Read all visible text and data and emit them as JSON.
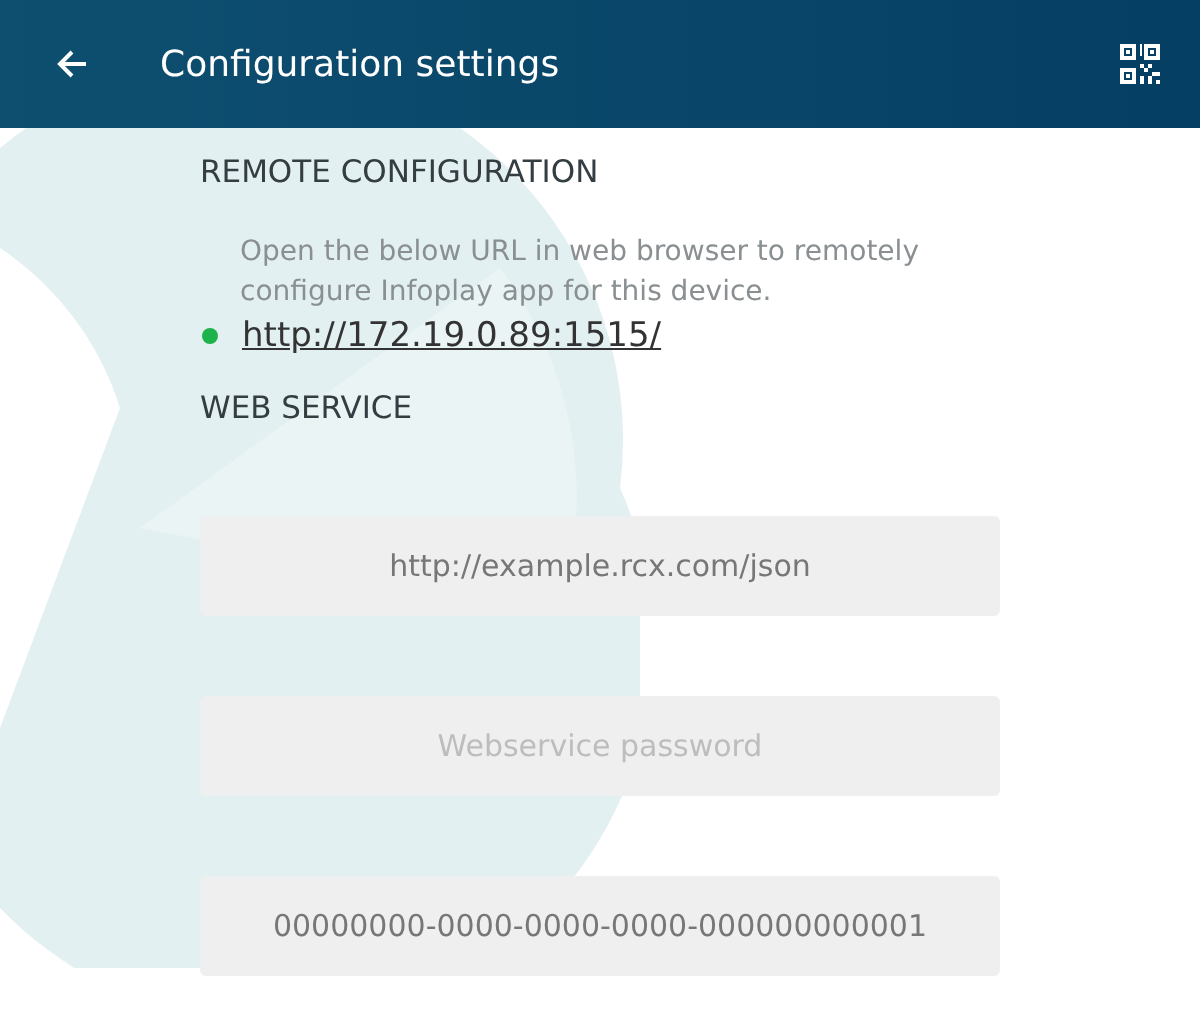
{
  "app_bar": {
    "title": "Configuration settings"
  },
  "remote_configuration": {
    "heading": "REMOTE CONFIGURATION",
    "description": "Open the below URL in web browser to remotely configure Infoplay app for this device.",
    "url": "http://172.19.0.89:1515/",
    "online": true
  },
  "web_service": {
    "heading": "WEB SERVICE",
    "fields": [
      {
        "value": "http://example.rcx.com/json"
      },
      {
        "placeholder": "Webservice password"
      },
      {
        "value": "00000000-0000-0000-0000-000000000001"
      }
    ]
  }
}
